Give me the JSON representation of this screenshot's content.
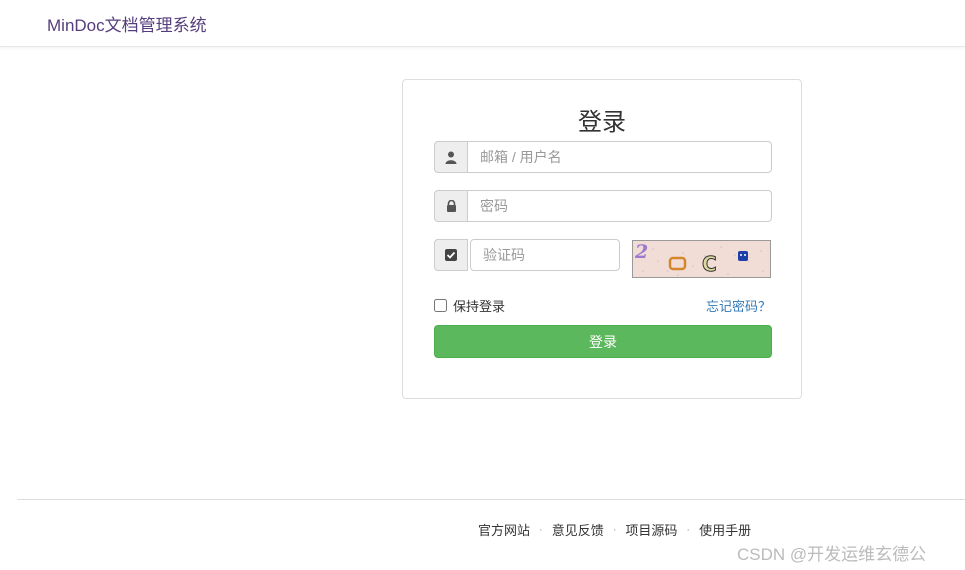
{
  "header": {
    "brand": "MinDoc文档管理系统"
  },
  "login": {
    "title": "登录",
    "username_placeholder": "邮箱 / 用户名",
    "password_placeholder": "密码",
    "captcha_placeholder": "验证码",
    "remember_label": "保持登录",
    "forgot_label": "忘记密码？",
    "submit_label": "登录"
  },
  "footer": {
    "links": [
      "官方网站",
      "意见反馈",
      "项目源码",
      "使用手册"
    ],
    "separator": "·"
  },
  "watermark": "CSDN @开发运维玄德公",
  "colors": {
    "brand": "#563d7c",
    "submit": "#5cb85c",
    "link": "#337ab7"
  }
}
